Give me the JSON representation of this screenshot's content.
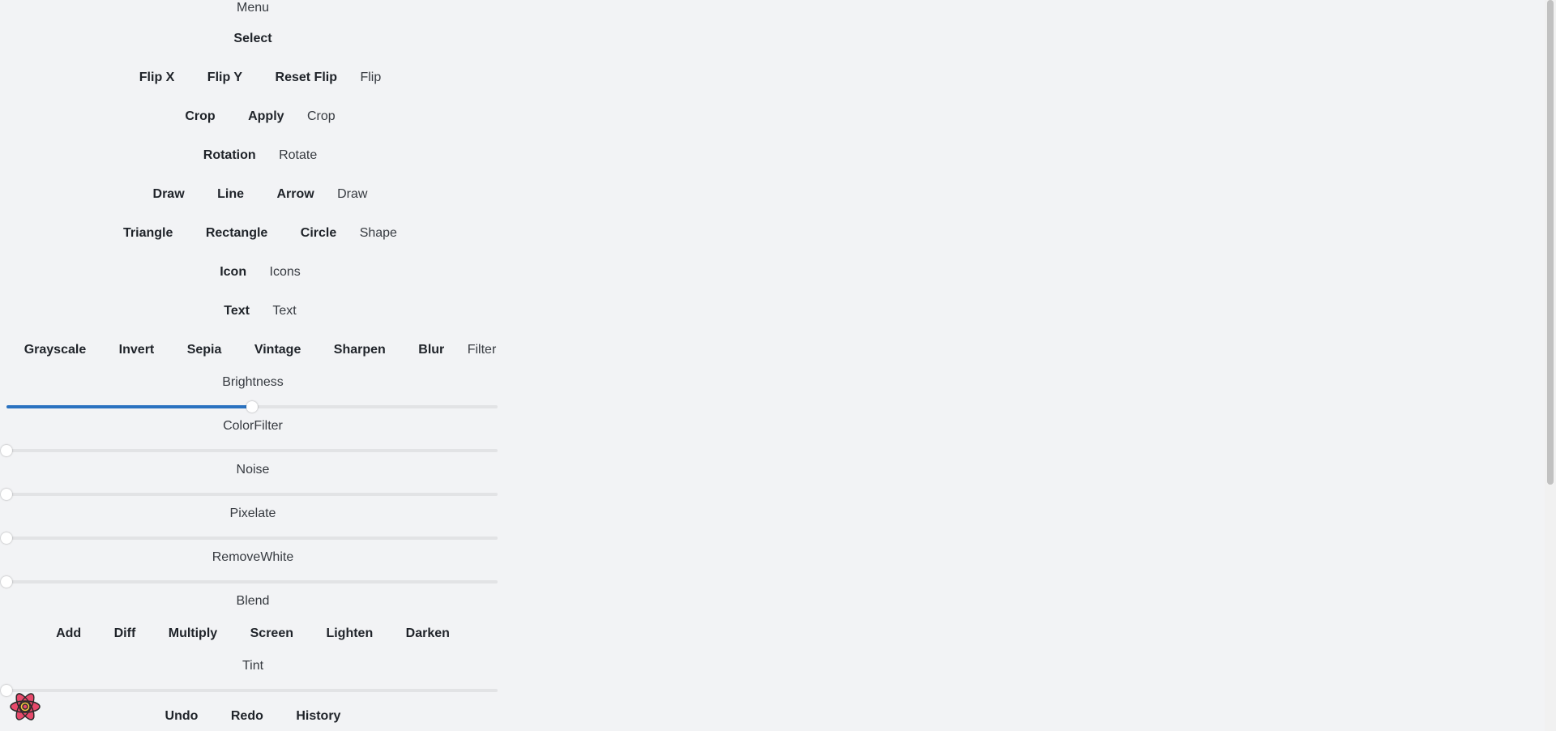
{
  "menu_title": "Menu",
  "select_label": "Select",
  "flip": {
    "buttons": [
      "Flip X",
      "Flip Y",
      "Reset Flip"
    ],
    "label": "Flip"
  },
  "crop": {
    "buttons": [
      "Crop",
      "Apply"
    ],
    "label": "Crop"
  },
  "rotate": {
    "buttons": [
      "Rotation"
    ],
    "label": "Rotate"
  },
  "draw": {
    "buttons": [
      "Draw",
      "Line",
      "Arrow"
    ],
    "label": "Draw"
  },
  "shape": {
    "buttons": [
      "Triangle",
      "Rectangle",
      "Circle"
    ],
    "label": "Shape"
  },
  "icons": {
    "buttons": [
      "Icon"
    ],
    "label": "Icons"
  },
  "text": {
    "buttons": [
      "Text"
    ],
    "label": "Text"
  },
  "filter": {
    "buttons": [
      "Grayscale",
      "Invert",
      "Sepia",
      "Vintage",
      "Sharpen",
      "Blur"
    ],
    "label": "Filter"
  },
  "sliders": {
    "brightness": {
      "label": "Brightness",
      "value": 0.5
    },
    "colorfilter": {
      "label": "ColorFilter",
      "value": 0
    },
    "noise": {
      "label": "Noise",
      "value": 0
    },
    "pixelate": {
      "label": "Pixelate",
      "value": 0
    },
    "removewhite": {
      "label": "RemoveWhite",
      "value": 0
    },
    "tint": {
      "label": "Tint",
      "value": 0
    }
  },
  "blend": {
    "label": "Blend",
    "buttons": [
      "Add",
      "Diff",
      "Multiply",
      "Screen",
      "Lighten",
      "Darken"
    ]
  },
  "history": {
    "buttons": [
      "Undo",
      "Redo",
      "History"
    ]
  },
  "colors": {
    "accent": "#2a72c0",
    "background": "#f2f3f5",
    "track": "#e2e3e5",
    "logo": "#e8496b"
  },
  "icons_meta": {
    "logo": "react-atom-logo-icon"
  }
}
